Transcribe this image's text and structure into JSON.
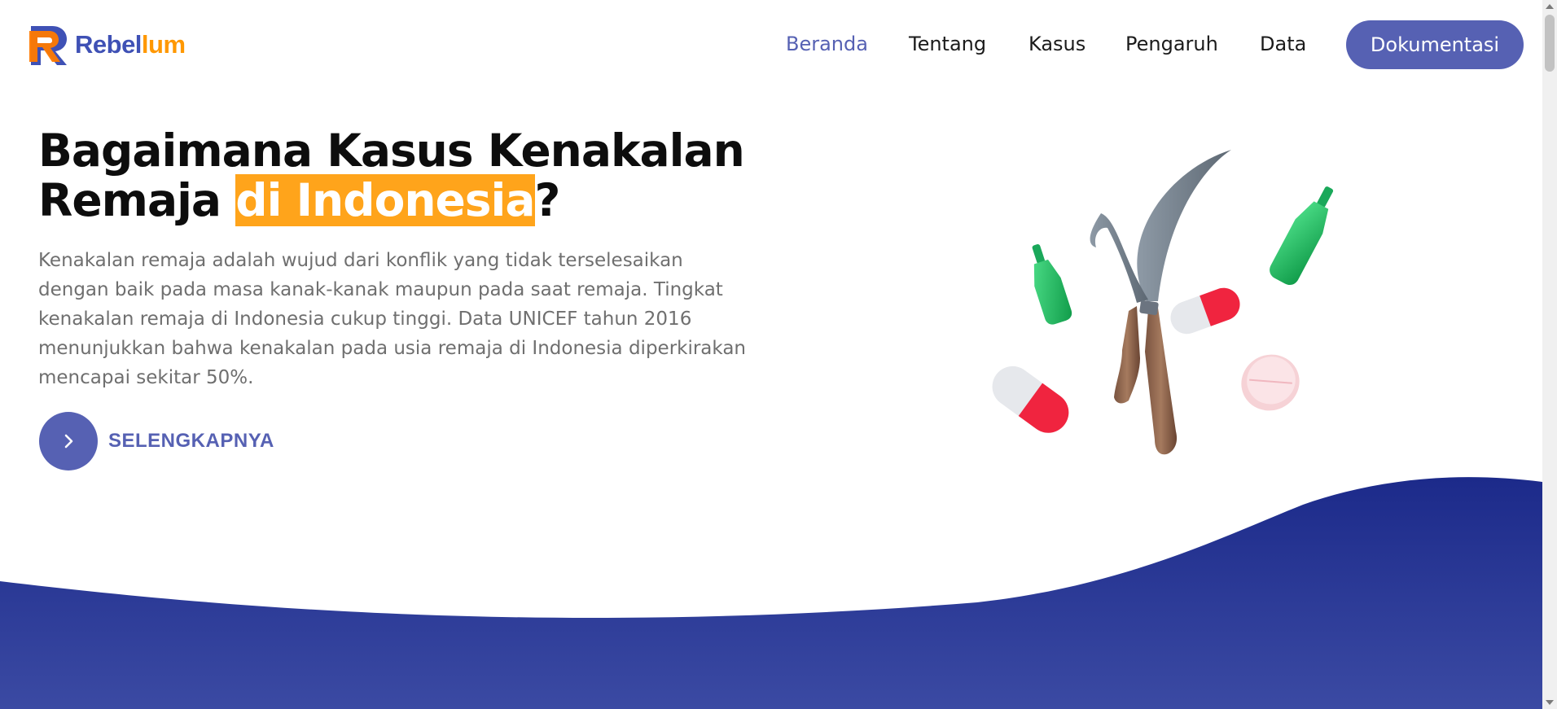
{
  "brand": {
    "name_part1": "Rebel",
    "name_part2": "lum",
    "primary": "#3f51b5",
    "accent": "#ff9800"
  },
  "nav": {
    "items": [
      {
        "label": "Beranda",
        "active": true
      },
      {
        "label": "Tentang",
        "active": false
      },
      {
        "label": "Kasus",
        "active": false
      },
      {
        "label": "Pengaruh",
        "active": false
      },
      {
        "label": "Data",
        "active": false
      }
    ],
    "button_label": "Dokumentasi"
  },
  "hero": {
    "title_line1": "Bagaimana Kasus Kenakalan",
    "title_line2_pre": "Remaja ",
    "title_highlight": "di Indonesia",
    "title_line2_post": "?",
    "description": "Kenakalan remaja adalah wujud dari konflik yang tidak terselesaikan dengan baik pada masa kanak-kanak maupun pada saat remaja. Tingkat kenakalan remaja di Indonesia cukup tinggi. Data UNICEF tahun 2016 menunjukkan bahwa kenakalan pada usia remaja di Indonesia diperkirakan mencapai sekitar 50%.",
    "cta_label": "SELENGKAPNYA",
    "cta_icon": "chevron-right-icon"
  },
  "colors": {
    "button": "#5661b3",
    "highlight": "#ffa41b",
    "wave_top": "#1a237e",
    "wave_bottom": "#3949ab"
  }
}
